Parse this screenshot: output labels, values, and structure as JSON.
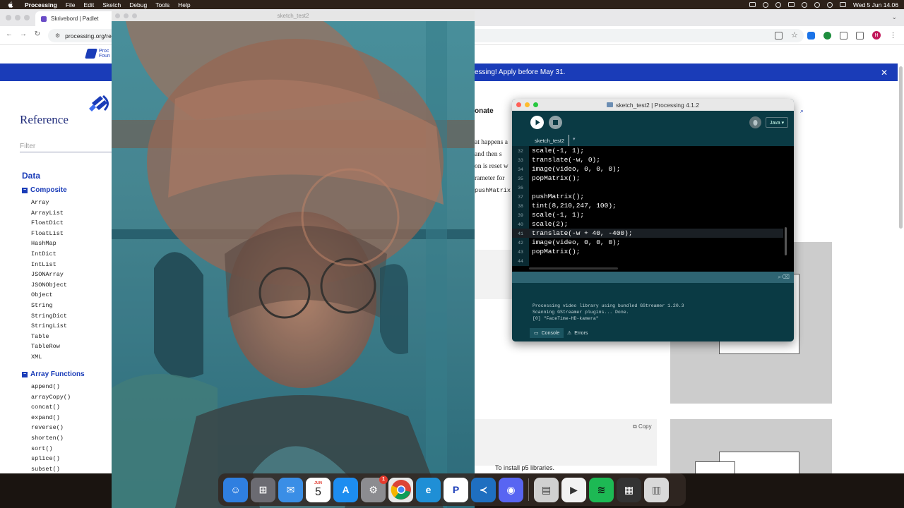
{
  "menubar": {
    "app_name": "Processing",
    "menus": [
      "File",
      "Edit",
      "Sketch",
      "Debug",
      "Tools",
      "Help"
    ],
    "clock": "Wed 5 Jun 14.06"
  },
  "browser": {
    "tab_title": "Skrivebord | Padlet",
    "url": "processing.org/ref",
    "banner_text": "essing! Apply before May 31.",
    "profile_initial": "H"
  },
  "reference": {
    "logo_text": "Proc\nFoun",
    "title": "Reference",
    "filter_placeholder": "Filter",
    "section": "Data",
    "composite_label": "Composite",
    "composite_items": [
      "Array",
      "ArrayList",
      "FloatDict",
      "FloatList",
      "HashMap",
      "IntDict",
      "IntList",
      "JSONArray",
      "JSONObject",
      "Object",
      "String",
      "StringDict",
      "StringList",
      "Table",
      "TableRow",
      "XML"
    ],
    "array_functions_label": "Array Functions",
    "array_functions_items": [
      "append()",
      "arrayCopy()",
      "concat()",
      "expand()",
      "reverse()",
      "shorten()",
      "sort()",
      "splice()",
      "subset()"
    ]
  },
  "page": {
    "donate": "onate",
    "body_lines": [
      "at happens a",
      "and then s",
      "on is reset w",
      "rameter for",
      "pushMatrix"
    ],
    "copy_label": "Copy",
    "footer_text": "To install p5 libraries."
  },
  "sketch_window": {
    "title": "sketch_test2"
  },
  "ide": {
    "title": "sketch_test2 | Processing 4.1.2",
    "mode": "Java ▾",
    "tab_name": "sketch_test2",
    "code_lines": [
      {
        "n": "32",
        "text": "scale(-1, 1);"
      },
      {
        "n": "33",
        "text": "translate(-w, 0);"
      },
      {
        "n": "34",
        "text": "image(video, 0, 0, 0);"
      },
      {
        "n": "35",
        "text": "popMatrix();"
      },
      {
        "n": "36",
        "text": ""
      },
      {
        "n": "37",
        "text": "pushMatrix();"
      },
      {
        "n": "38",
        "text": "tint(8,210,247, 100);"
      },
      {
        "n": "39",
        "text": "scale(-1, 1);"
      },
      {
        "n": "40",
        "text": "scale(2);"
      },
      {
        "n": "41",
        "text": "translate(-w + 40, -400);"
      },
      {
        "n": "42",
        "text": "image(video, 0, 0, 0);"
      },
      {
        "n": "43",
        "text": "popMatrix();"
      },
      {
        "n": "44",
        "text": ""
      }
    ],
    "console_lines": [
      "Processing video library using bundled GStreamer 1.20.3",
      "Scanning GStreamer plugins... Done.",
      "[0] \"FaceTime-HD-kamera\""
    ],
    "console_tab": "Console",
    "errors_tab": "Errors"
  },
  "dock": {
    "calendar_month": "JUN",
    "calendar_day": "5",
    "settings_badge": "1",
    "apps": [
      {
        "name": "Finder",
        "color": "#2f7fe0"
      },
      {
        "name": "Launchpad",
        "color": "#6b6b72"
      },
      {
        "name": "Mail",
        "color": "#3a8ee6"
      },
      {
        "name": "Calendar",
        "color": "#ffffff"
      },
      {
        "name": "App Store",
        "color": "#1d8df0"
      },
      {
        "name": "System Settings",
        "color": "#8c8c90"
      },
      {
        "name": "Chrome",
        "color": "#e8e8e8"
      },
      {
        "name": "Edge",
        "color": "#1f8fd6"
      },
      {
        "name": "Processing",
        "color": "#ffffff"
      },
      {
        "name": "VS Code",
        "color": "#1f6fc0"
      },
      {
        "name": "Discord",
        "color": "#5865f2"
      },
      {
        "name": "Preview",
        "color": "#d0d0d0"
      },
      {
        "name": "QuickTime",
        "color": "#f2f2f2"
      },
      {
        "name": "Spotify",
        "color": "#1db954"
      },
      {
        "name": "Screen",
        "color": "#333333"
      },
      {
        "name": "Trash",
        "color": "#d9d9d9"
      }
    ]
  }
}
